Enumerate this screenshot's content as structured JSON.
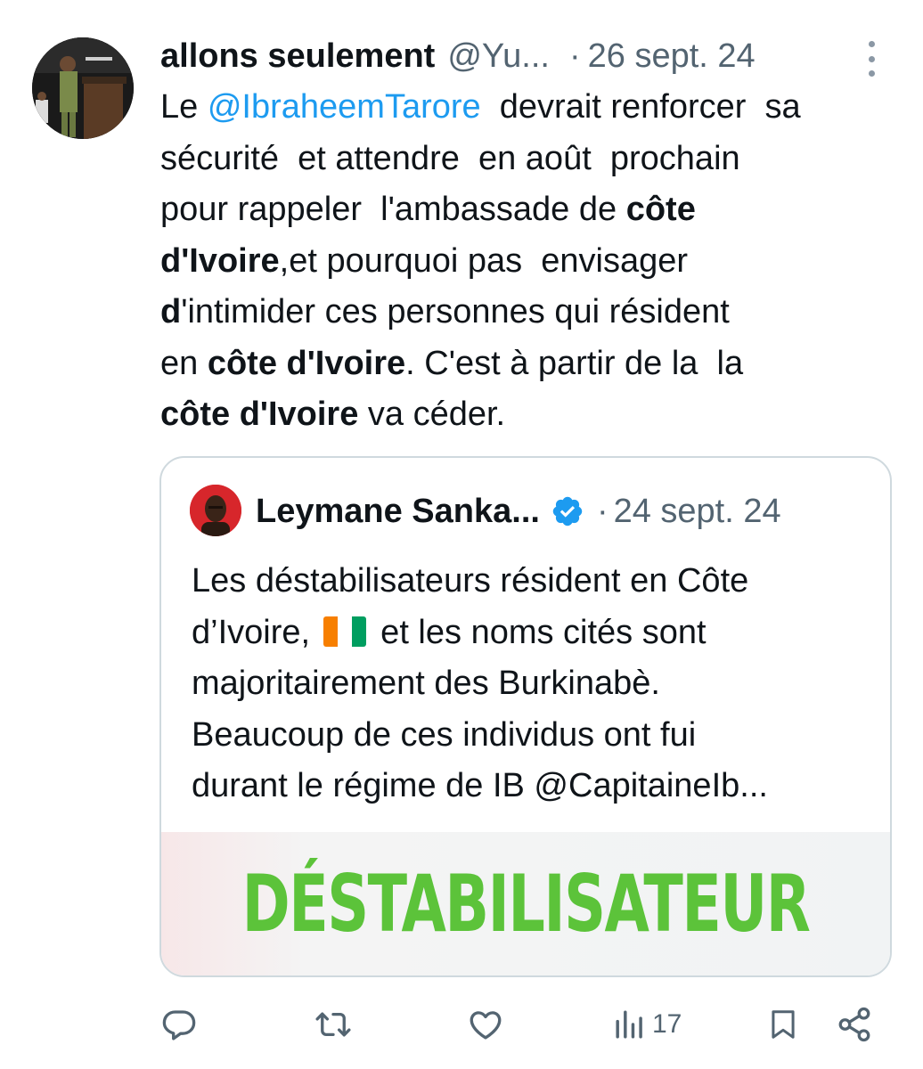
{
  "tweet": {
    "author": {
      "name": "allons seulement",
      "handle": "@Yu...",
      "separator": "·",
      "date": "26 sept. 24"
    },
    "lines": [
      [
        {
          "t": "Le "
        },
        {
          "t": "@IbraheemTarore",
          "s": "mention"
        },
        {
          "t": "  devrait renforcer  sa"
        }
      ],
      [
        {
          "t": "sécurité  et attendre  en août  prochain"
        }
      ],
      [
        {
          "t": "pour rappeler  l'ambassade de "
        },
        {
          "t": "côte",
          "s": "b"
        }
      ],
      [
        {
          "t": "d'Ivoire",
          "s": "b"
        },
        {
          "t": ",et pourquoi pas  envisager"
        }
      ],
      [
        {
          "t": "d",
          "s": "b"
        },
        {
          "t": "'intimider ces personnes qui résident"
        }
      ],
      [
        {
          "t": "en "
        },
        {
          "t": "côte d'Ivoire",
          "s": "b"
        },
        {
          "t": ". C'est à partir de la  la"
        }
      ],
      [
        {
          "t": "côte d'Ivoire",
          "s": "b"
        },
        {
          "t": " va céder."
        }
      ]
    ],
    "quote": {
      "name": "Leymane Sanka...",
      "verified": true,
      "separator": "·",
      "date": "24 sept. 24",
      "lines": [
        [
          {
            "t": "Les déstabilisateurs résident en Côte"
          }
        ],
        [
          {
            "t": "d’Ivoire, "
          },
          {
            "flag": [
              "#f77f00",
              "#ffffff",
              "#009e60"
            ]
          },
          {
            "t": " et les noms cités sont"
          }
        ],
        [
          {
            "t": "majoritairement des Burkinabè."
          }
        ],
        [
          {
            "t": "Beaucoup de ces individus ont fui"
          }
        ],
        [
          {
            "t": "durant le régime de IB @CapitaineIb..."
          }
        ]
      ],
      "image_text": "DÉSTABILISATEUR"
    },
    "actions": {
      "reply": {
        "icon": "reply-icon"
      },
      "retweet": {
        "icon": "retweet-icon"
      },
      "like": {
        "icon": "heart-icon"
      },
      "views": {
        "icon": "views-icon",
        "count": "17"
      },
      "bookmark": {
        "icon": "bookmark-icon"
      },
      "share": {
        "icon": "share-icon"
      }
    },
    "colors": {
      "text": "#0f1419",
      "secondary": "#536471",
      "link": "#1d9bf0",
      "verified": "#1d9bf0",
      "image_text": "#5cc33a"
    }
  }
}
